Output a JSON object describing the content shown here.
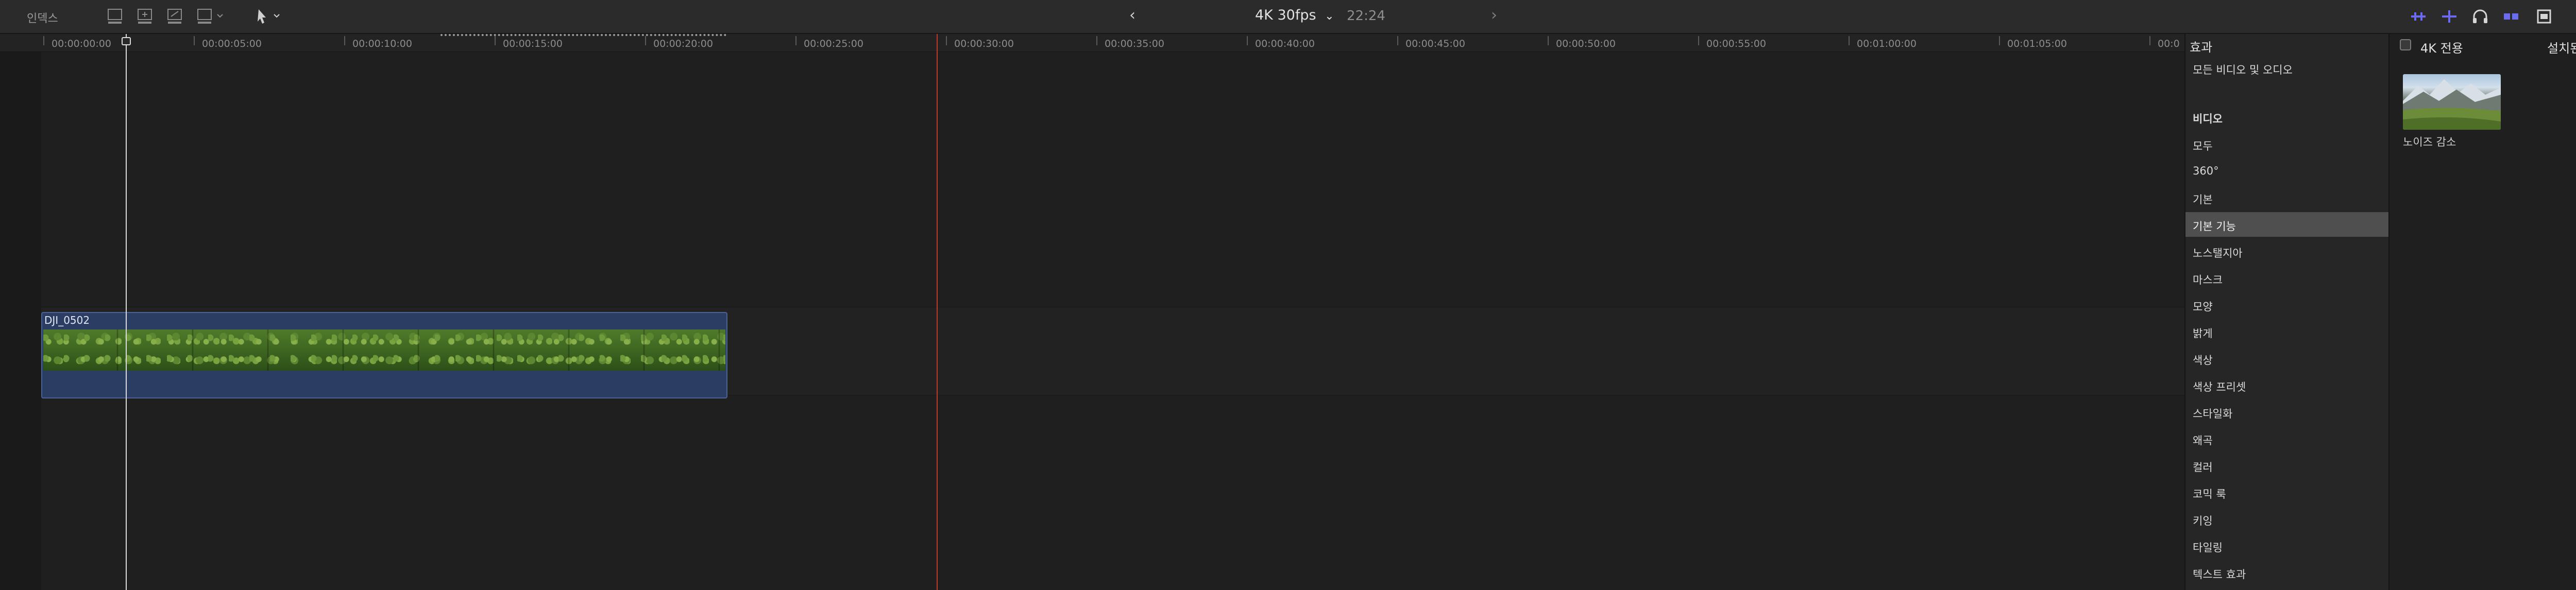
{
  "toolbar": {
    "index_label": "인덱스",
    "format_label": "4K 30fps",
    "format_chevron": "⌄",
    "timecode": "22:24",
    "prev_arrow": "‹",
    "next_arrow": "›",
    "icons": [
      "clip-append-icon",
      "clip-insert-icon",
      "clip-overwrite-icon",
      "clip-connect-icon",
      "select-tool-icon"
    ],
    "right_icons": [
      "audio-meter-icon",
      "skimming-icon",
      "headphones-icon",
      "snapping-icon",
      "clip-appearance-icon",
      "browser-toggle-icon",
      "effects-toggle-icon"
    ],
    "accent_color": "#6b6bf0"
  },
  "timeline": {
    "ruler_ticks": [
      "00:00:00:00",
      "00:00:05:00",
      "00:00:10:00",
      "00:00:15:00",
      "00:00:20:00",
      "00:00:25:00",
      "00:00:30:00",
      "00:00:35:00",
      "00:00:40:00",
      "00:00:45:00",
      "00:00:50:00",
      "00:00:55:00",
      "00:01:00:00",
      "00:01:05:00",
      "00:0"
    ],
    "clip": {
      "name": "DJI_0502",
      "color": "#2c3d64"
    },
    "skimmer_color": "#c0392b"
  },
  "effects": {
    "title": "효과",
    "categories": [
      {
        "label": "모든 비디오 및 오디오",
        "selected": false
      },
      {
        "label": "비디오",
        "selected": false
      },
      {
        "label": "모두",
        "selected": false
      },
      {
        "label": "360°",
        "selected": false
      },
      {
        "label": "기본",
        "selected": false
      },
      {
        "label": "기본 기능",
        "selected": true
      },
      {
        "label": "노스탤지아",
        "selected": false
      },
      {
        "label": "마스크",
        "selected": false
      },
      {
        "label": "모양",
        "selected": false
      },
      {
        "label": "밝게",
        "selected": false
      },
      {
        "label": "색상",
        "selected": false
      },
      {
        "label": "색상 프리셋",
        "selected": false
      },
      {
        "label": "스타일화",
        "selected": false
      },
      {
        "label": "왜곡",
        "selected": false
      },
      {
        "label": "컬러",
        "selected": false
      },
      {
        "label": "코믹 룩",
        "selected": false
      },
      {
        "label": "키잉",
        "selected": false
      },
      {
        "label": "타일링",
        "selected": false
      },
      {
        "label": "텍스트 효과",
        "selected": false
      }
    ]
  },
  "browser": {
    "only_4k_label": "4K 전용",
    "installed_label": "설치된 효과",
    "installed_arrow": "⌃⌄",
    "effect_items": [
      {
        "label": "노이즈 감소"
      }
    ]
  }
}
